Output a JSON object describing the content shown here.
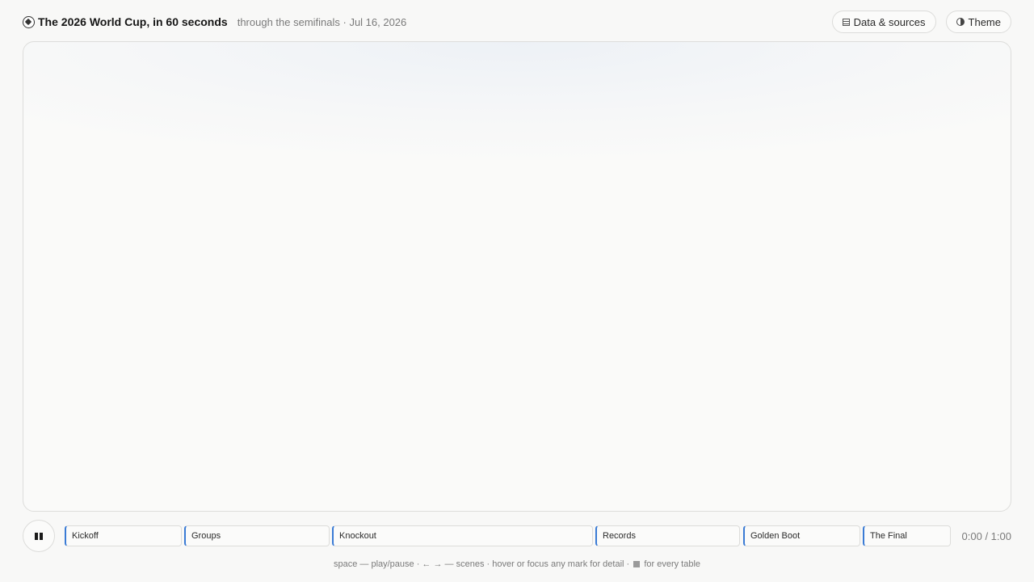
{
  "header": {
    "title": "The 2026 World Cup, in 60 seconds",
    "subtitle": "through the semifinals · Jul 16, 2026",
    "title_icon": "soccer-ball-icon",
    "actions": {
      "data_sources_label": "Data & sources",
      "theme_label": "Theme"
    }
  },
  "controls": {
    "play_state": "playing",
    "scenes": [
      {
        "label": "Kickoff"
      },
      {
        "label": "Groups"
      },
      {
        "label": "Knockout"
      },
      {
        "label": "Records"
      },
      {
        "label": "Golden Boot"
      },
      {
        "label": "The Final"
      }
    ],
    "timecode": "0:00 / 1:00"
  },
  "hint": {
    "text_before": "space — play/pause · ← → — scenes · hover or focus any mark for detail ·",
    "text_after": "for every table"
  },
  "colors": {
    "accent": "#3a7bd5",
    "background": "#f8f8f7"
  }
}
